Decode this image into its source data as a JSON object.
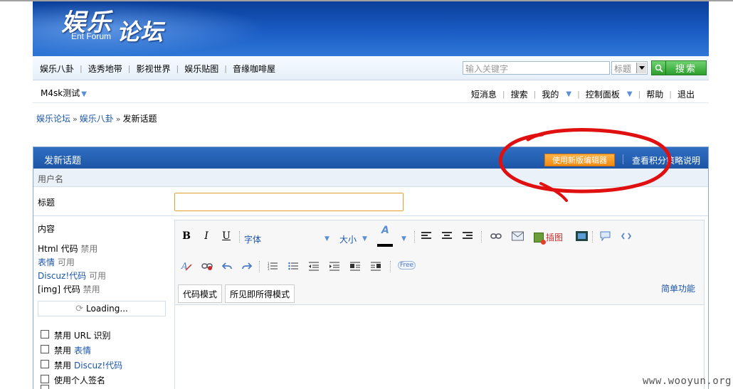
{
  "header": {
    "logo_cn_part1": "娱乐",
    "logo_cn_part2": "论坛",
    "logo_en": "Ent Forum"
  },
  "nav": {
    "items": [
      "娱乐八卦",
      "选秀地带",
      "影视世界",
      "娱乐贴图",
      "音缘咖啡屋"
    ],
    "search_placeholder": "输入关键字",
    "search_scope": "标题",
    "search_button": "搜索"
  },
  "userbar": {
    "username": "M4sk测试",
    "links": {
      "messages": "短消息",
      "search": "搜索",
      "mine": "我的",
      "control_panel": "控制面板",
      "help": "帮助",
      "logout": "退出"
    }
  },
  "breadcrumb": {
    "forum": "娱乐论坛",
    "board": "娱乐八卦",
    "current": "发新话题"
  },
  "post": {
    "box_title": "发新话题",
    "new_editor_button": "使用新版编辑器",
    "head_link": "查看积分策略说明",
    "username_label": "用户名",
    "title_label": "标题",
    "title_value": "",
    "content_label": "内容",
    "options": {
      "html_label": "Html 代码",
      "html_state": "禁用",
      "smilies_label": "表情",
      "smilies_state": "可用",
      "discuz_label": "Discuz!代码",
      "discuz_state": "可用",
      "img_label": "[img] 代码",
      "img_state": "禁用"
    },
    "loading_text": "Loading...",
    "checkboxes": {
      "disable_url_prefix": "禁用",
      "disable_url_text": "URL 识别",
      "disable_smilies_prefix": "禁用",
      "disable_smilies_text": "表情",
      "disable_discuz_prefix": "禁用",
      "disable_discuz_text": "Discuz!代码",
      "use_signature": "使用个人签名"
    }
  },
  "editor": {
    "bold": "B",
    "italic": "I",
    "underline": "U",
    "font_label": "字体",
    "size_label": "大小",
    "color_letter": "A",
    "insert_image": "插图",
    "free_badge": "Free",
    "tab_code": "代码模式",
    "tab_wysiwyg": "所见即所得模式",
    "simple_mode": "简单功能"
  },
  "watermark": "www.wooyun.org",
  "colors": {
    "header_blue": "#1a5cc4",
    "link_blue": "#1b56a8",
    "annotation_red": "#e01010",
    "orange_button": "#f28a12",
    "green_button": "#2c9e2c"
  }
}
